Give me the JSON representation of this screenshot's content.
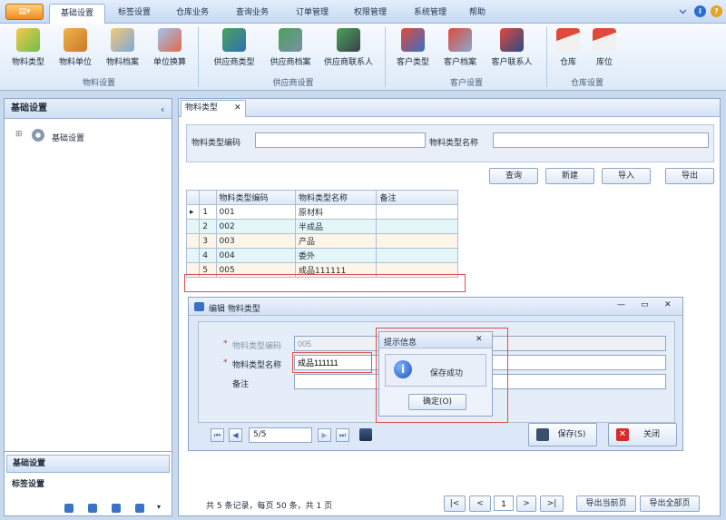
{
  "menu": {
    "app_button": "▤▾",
    "tabs": [
      "基础设置",
      "标签设置",
      "仓库业务",
      "查询业务",
      "订单管理",
      "权限管理",
      "系统管理",
      "帮助"
    ],
    "active": "基础设置"
  },
  "ribbon": {
    "groups": [
      {
        "name": "物料设置",
        "buttons": [
          "物料类型",
          "物料单位",
          "物料档案",
          "单位换算"
        ]
      },
      {
        "name": "供应商设置",
        "buttons": [
          "供应商类型",
          "供应商档案",
          "供应商联系人"
        ]
      },
      {
        "name": "客户设置",
        "buttons": [
          "客户类型",
          "客户档案",
          "客户联系人"
        ]
      },
      {
        "name": "仓库设置",
        "buttons": [
          "仓库",
          "库位"
        ]
      }
    ]
  },
  "left": {
    "title": "基础设置",
    "collapse": "‹",
    "tree_root": "基础设置",
    "tree_expander": "⊞",
    "bottom_items": [
      "基础设置",
      "标签设置"
    ]
  },
  "tab": {
    "label": "物料类型",
    "close": "✕"
  },
  "search": {
    "code_label": "物料类型编码",
    "name_label": "物料类型名称",
    "code_value": "",
    "name_value": ""
  },
  "actions": [
    "查询",
    "新建",
    "导入",
    "导出"
  ],
  "grid": {
    "headers": [
      "",
      "",
      "物料类型编码",
      "物料类型名称",
      "备注"
    ],
    "rows": [
      {
        "marker": "▸",
        "no": "1",
        "code": "001",
        "name": "原材料",
        "note": ""
      },
      {
        "marker": "",
        "no": "2",
        "code": "002",
        "name": "半成品",
        "note": ""
      },
      {
        "marker": "",
        "no": "3",
        "code": "003",
        "name": "产品",
        "note": ""
      },
      {
        "marker": "",
        "no": "4",
        "code": "004",
        "name": "委外",
        "note": ""
      },
      {
        "marker": "",
        "no": "5",
        "code": "005",
        "name": "成品111111",
        "note": ""
      }
    ]
  },
  "edit": {
    "title": "编辑 物料类型",
    "star": "*",
    "code_label": "物料类型编码",
    "code_value": "005",
    "name_label": "物料类型名称",
    "name_value": "成品111111",
    "note_label": "备注",
    "note_value": "",
    "nav_pos": "5/5",
    "save": "保存(S)",
    "close": "关闭",
    "win_min": "—",
    "win_max": "▭",
    "win_close": "✕"
  },
  "msg": {
    "title": "提示信息",
    "text": "保存成功",
    "ok": "确定(O)",
    "close": "✕"
  },
  "footer": {
    "summary": "共 5 条记录，每页 50 条，共 1 页",
    "page": "1",
    "first": "|<",
    "prev": "<",
    "next": ">",
    "last": ">|",
    "export_cur": "导出当前页",
    "export_all": "导出全部页"
  },
  "colors": {
    "accent": "#3a62a8",
    "highlight": "#e05050"
  }
}
